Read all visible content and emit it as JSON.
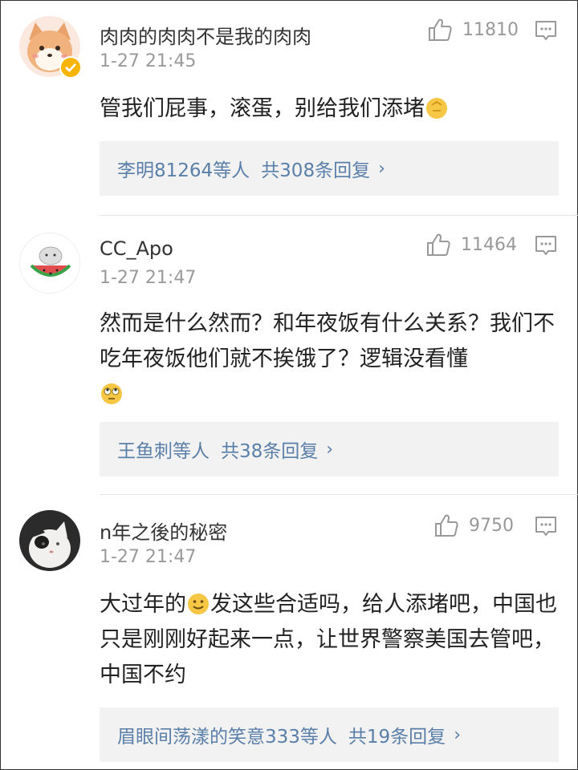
{
  "comments": [
    {
      "username": "肉肉的肉肉不是我的肉肉",
      "time": "1-27 21:45",
      "likes": "11810",
      "text": "管我们屁事，滚蛋，别给我们添堵",
      "reply_users": "李明81264等人",
      "reply_count": "共308条回复",
      "avatar_icon": "shiba-dog-avatar",
      "verified": true
    },
    {
      "username": "CC_Apo",
      "time": "1-27 21:47",
      "likes": "11464",
      "text": "然而是什么然而？和年夜饭有什么关系？我们不吃年夜饭他们就不挨饿了？逻辑没看懂",
      "reply_users": "王鱼刺等人",
      "reply_count": "共38条回复",
      "avatar_icon": "watermelon-cat-avatar"
    },
    {
      "username": "n年之後的秘密",
      "time": "1-27 21:47",
      "likes": "9750",
      "text_part1": "大过年的",
      "text_part2": "发这些合适吗，给人添堵吧，中国也只是刚刚好起来一点，让世界警察美国去管吧，中国不约",
      "reply_users": "眉眼间荡漾的笑意333等人",
      "reply_count": "共19条回复",
      "avatar_icon": "cat-photo-avatar"
    }
  ],
  "colors": {
    "link": "#5a7fa8",
    "muted": "#9a9a9a",
    "reply_bg": "#f2f2f2"
  }
}
